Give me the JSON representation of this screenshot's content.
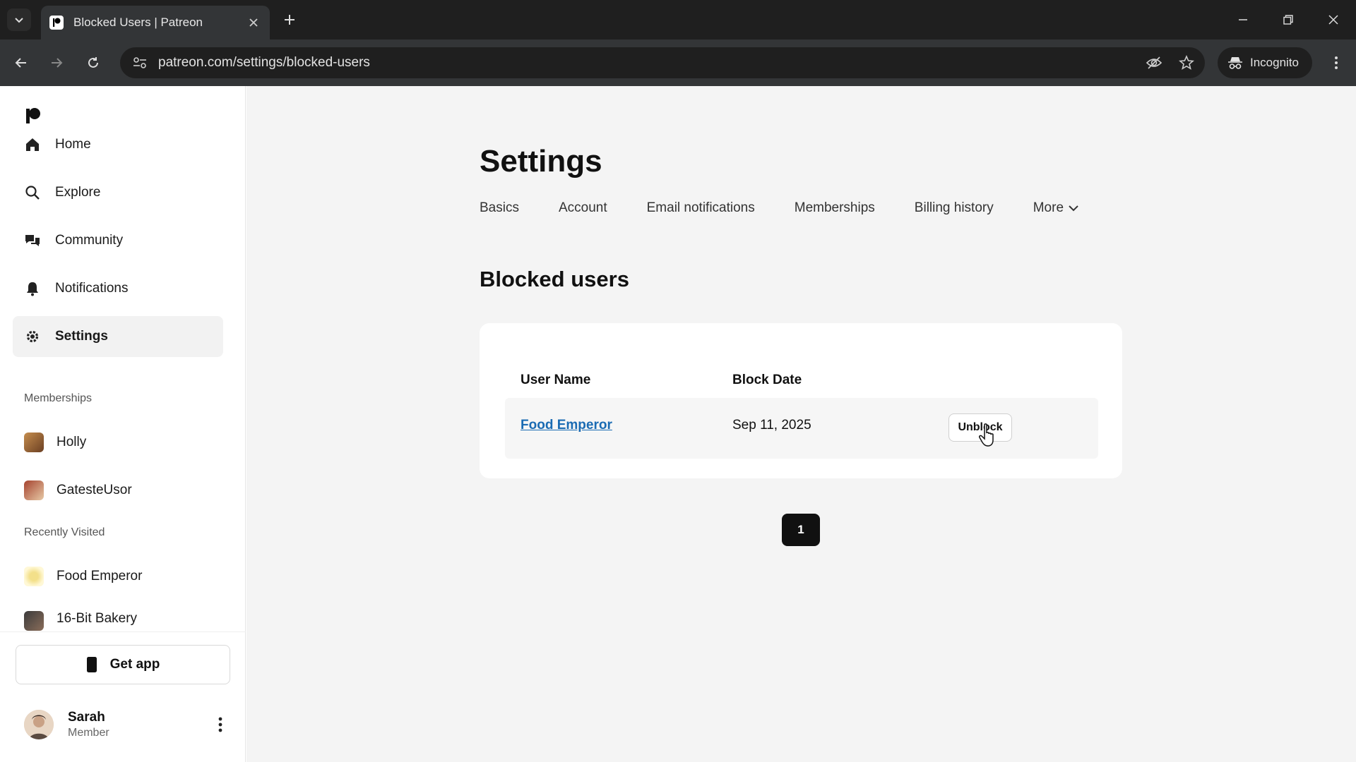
{
  "browser": {
    "tab_title": "Blocked Users | Patreon",
    "url": "patreon.com/settings/blocked-users",
    "incognito_label": "Incognito"
  },
  "sidebar": {
    "nav": [
      {
        "label": "Home",
        "icon": "home-icon"
      },
      {
        "label": "Explore",
        "icon": "search-icon"
      },
      {
        "label": "Community",
        "icon": "chat-bubbles-icon"
      },
      {
        "label": "Notifications",
        "icon": "bell-icon"
      },
      {
        "label": "Settings",
        "icon": "gear-icon",
        "active": true
      }
    ],
    "memberships_label": "Memberships",
    "memberships": [
      {
        "label": "Holly"
      },
      {
        "label": "GatesteUsor"
      }
    ],
    "recent_label": "Recently Visited",
    "recent": [
      {
        "label": "Food Emperor"
      },
      {
        "label": "16-Bit Bakery"
      }
    ],
    "get_app_label": "Get app",
    "user": {
      "name": "Sarah",
      "role": "Member"
    }
  },
  "main": {
    "title": "Settings",
    "tabs": [
      "Basics",
      "Account",
      "Email notifications",
      "Memberships",
      "Billing history",
      "More"
    ],
    "section_title": "Blocked users",
    "table": {
      "headers": [
        "User Name",
        "Block Date"
      ],
      "rows": [
        {
          "user": "Food Emperor",
          "date": "Sep 11, 2025",
          "action": "Unblock"
        }
      ]
    },
    "pagination": {
      "current_page": "1"
    }
  },
  "colors": {
    "link": "#1a6bb3",
    "chrome_dark": "#1f1f1f",
    "page_bg": "#f4f4f4"
  }
}
